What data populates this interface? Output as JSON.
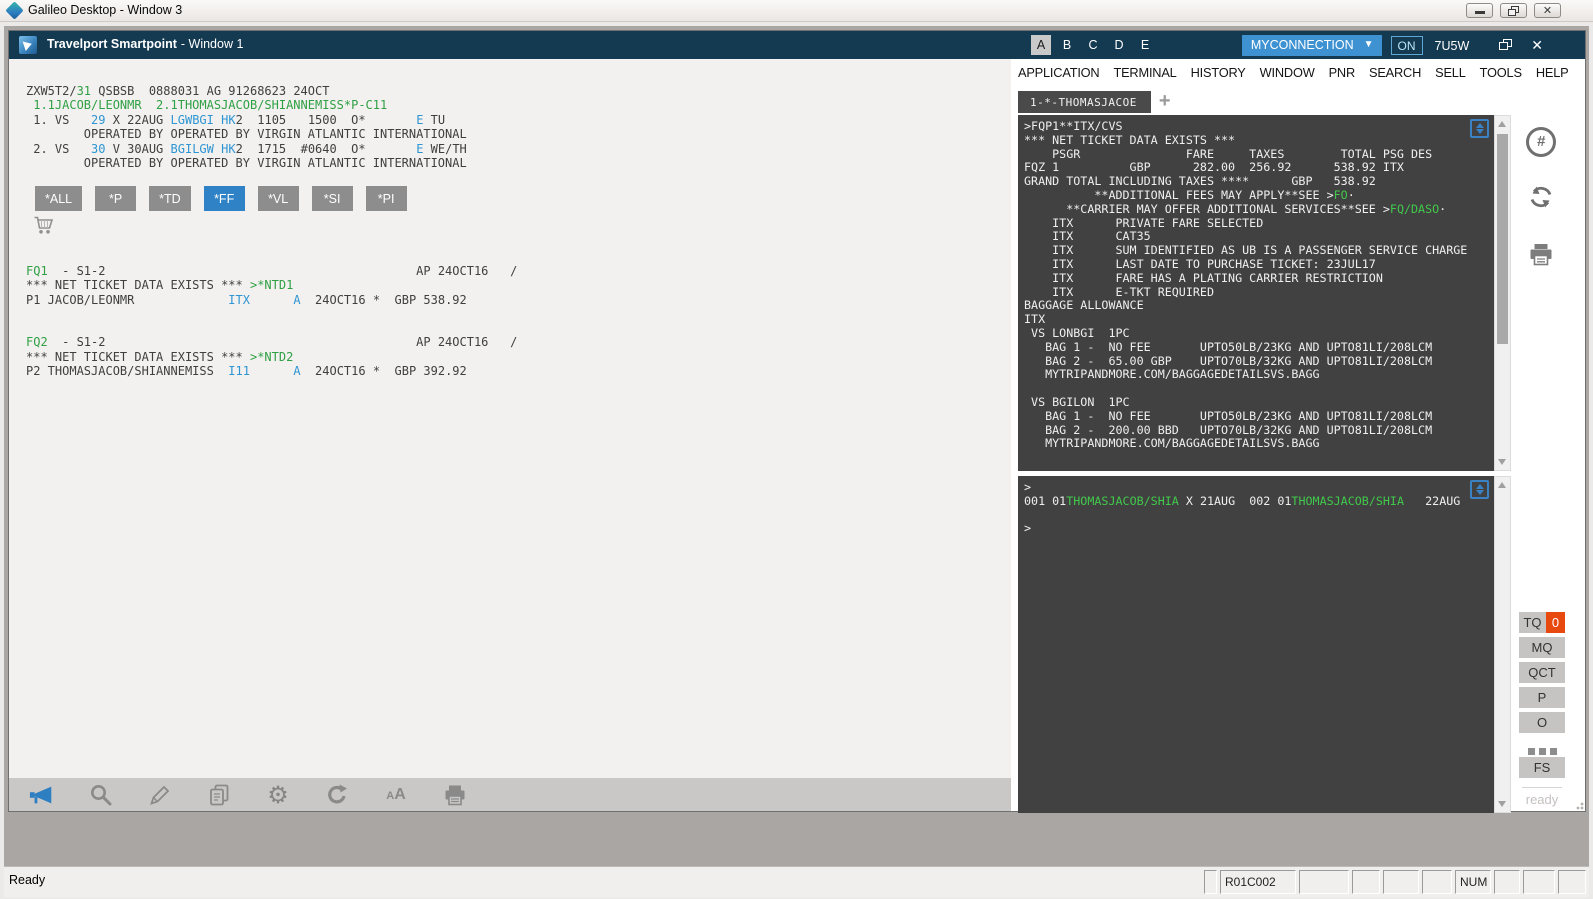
{
  "colors": {
    "titlebar": "#143a52",
    "accent_blue": "#2e82c5",
    "link_blue": "#2e95d3",
    "pnr_green": "#2fa044",
    "terminal_bg": "#414141",
    "terminal_green": "#41c94b",
    "alert_orange": "#e8490f",
    "panel_bg": "#f2f1ef",
    "button_gray": "#8d8d8d"
  },
  "outer": {
    "title": "Galileo Desktop - Window 3",
    "status_ready": "Ready",
    "status_cells": [
      "",
      "R01C002",
      "",
      "",
      "",
      "",
      "NUM",
      "",
      "",
      ""
    ]
  },
  "smartpoint": {
    "title_app": "Travelport Smartpoint",
    "title_window": "- Window 1",
    "view_tabs": [
      "A",
      "B",
      "C",
      "D",
      "E"
    ],
    "active_view_tab": "A",
    "connection_label": "MYCONNECTION",
    "on_label": "ON",
    "pcc": "7U5W",
    "menu": [
      "APPLICATION",
      "TERMINAL",
      "HISTORY",
      "WINDOW",
      "PNR",
      "SEARCH",
      "SELL",
      "TOOLS",
      "HELP"
    ]
  },
  "pnr": {
    "lines": [
      [
        [
          "ZXW5T2/",
          "d"
        ],
        [
          "31",
          "g"
        ],
        [
          " QSBSB  0888031 AG 91268623 24OCT",
          "d"
        ]
      ],
      [
        [
          " 1.1JACOB/LEONMR  2.1THOMASJACOB/SHIANNEMISS*P-C11",
          "g"
        ]
      ],
      [
        [
          " 1. VS   ",
          "d"
        ],
        [
          "29",
          "b"
        ],
        [
          " X 22AUG ",
          "d"
        ],
        [
          "LGWBGI",
          "b"
        ],
        [
          " ",
          "d"
        ],
        [
          "HK",
          "b"
        ],
        [
          "2",
          "d"
        ],
        [
          "  1105   1500  O*       ",
          "d"
        ],
        [
          "E",
          "b"
        ],
        [
          " TU",
          "d"
        ]
      ],
      [
        [
          "        OPERATED BY OPERATED BY VIRGIN ATLANTIC INTERNATIONAL",
          "d"
        ]
      ],
      [
        [
          " 2. VS   ",
          "d"
        ],
        [
          "30",
          "b"
        ],
        [
          " V 30AUG ",
          "d"
        ],
        [
          "BGILGW",
          "b"
        ],
        [
          " ",
          "d"
        ],
        [
          "HK",
          "b"
        ],
        [
          "2",
          "d"
        ],
        [
          "  1715  #0640  O*       ",
          "d"
        ],
        [
          "E",
          "b"
        ],
        [
          " WE/TH",
          "d"
        ]
      ],
      [
        [
          "        OPERATED BY OPERATED BY VIRGIN ATLANTIC INTERNATIONAL",
          "d"
        ]
      ]
    ],
    "format_buttons": [
      {
        "label": "*ALL",
        "active": false
      },
      {
        "label": "*P",
        "active": false
      },
      {
        "label": "*TD",
        "active": false
      },
      {
        "label": "*FF",
        "active": true
      },
      {
        "label": "*VL",
        "active": false
      },
      {
        "label": "*SI",
        "active": false
      },
      {
        "label": "*PI",
        "active": false
      }
    ],
    "fq_lines": [
      [
        [
          "FQ1",
          "g"
        ],
        [
          "  - S1-2                                           AP 24OCT16   /",
          "d"
        ]
      ],
      [
        [
          "*** NET TICKET DATA EXISTS *** ",
          "d"
        ],
        [
          ">*NTD1",
          "g"
        ]
      ],
      [
        [
          "P1 JACOB/LEONMR             ",
          "d"
        ],
        [
          "ITX",
          "b"
        ],
        [
          "      ",
          "d"
        ],
        [
          "A",
          "b"
        ],
        [
          "  24OCT16 *  GBP 538.92",
          "d"
        ]
      ],
      [],
      [],
      [
        [
          "FQ2",
          "g"
        ],
        [
          "  - S1-2                                           AP 24OCT16   /",
          "d"
        ]
      ],
      [
        [
          "*** NET TICKET DATA EXISTS *** ",
          "d"
        ],
        [
          ">*NTD2",
          "g"
        ]
      ],
      [
        [
          "P2 THOMASJACOB/SHIANNEMISS  ",
          "d"
        ],
        [
          "I11",
          "b"
        ],
        [
          "      ",
          "d"
        ],
        [
          "A",
          "b"
        ],
        [
          "  24OCT16 *  GBP 392.92",
          "d"
        ]
      ]
    ]
  },
  "terminal": {
    "session_tab": "1-*-THOMASJACOE",
    "new_session_label": "+",
    "screen1": [
      [
        [
          ">FQP1**ITX/CVS",
          "w"
        ]
      ],
      [
        [
          "*** NET TICKET DATA EXISTS ***",
          "w"
        ]
      ],
      [
        [
          "    PSGR               FARE     TAXES        TOTAL PSG DES",
          "w"
        ]
      ],
      [
        [
          "FQZ 1          GBP      282.00  256.92      538.92 ITX",
          "w"
        ]
      ],
      [
        [
          "GRAND TOTAL INCLUDING TAXES ****      GBP   538.92",
          "w"
        ]
      ],
      [
        [
          "          **ADDITIONAL FEES MAY APPLY**SEE >",
          "w"
        ],
        [
          "FO",
          "g"
        ],
        [
          "·",
          "w"
        ]
      ],
      [
        [
          "      **CARRIER MAY OFFER ADDITIONAL SERVICES**SEE >",
          "w"
        ],
        [
          "FQ/DASO",
          "g"
        ],
        [
          "·",
          "w"
        ]
      ],
      [
        [
          "    ITX      PRIVATE FARE SELECTED",
          "w"
        ]
      ],
      [
        [
          "    ITX      CAT35",
          "w"
        ]
      ],
      [
        [
          "    ITX      SUM IDENTIFIED AS UB IS A PASSENGER SERVICE CHARGE",
          "w"
        ]
      ],
      [
        [
          "    ITX      LAST DATE TO PURCHASE TICKET: 23JUL17",
          "w"
        ]
      ],
      [
        [
          "    ITX      FARE HAS A PLATING CARRIER RESTRICTION",
          "w"
        ]
      ],
      [
        [
          "    ITX      E-TKT REQUIRED",
          "w"
        ]
      ],
      [
        [
          "BAGGAGE ALLOWANCE",
          "w"
        ]
      ],
      [
        [
          "ITX",
          "w"
        ]
      ],
      [
        [
          " VS LONBGI  1PC",
          "w"
        ]
      ],
      [
        [
          "   BAG 1 -  NO FEE       UPTO50LB/23KG AND UPTO81LI/208LCM",
          "w"
        ]
      ],
      [
        [
          "   BAG 2 -  65.00 GBP    UPTO70LB/32KG AND UPTO81LI/208LCM",
          "w"
        ]
      ],
      [
        [
          "   MYTRIPANDMORE.COM/BAGGAGEDETAILSVS.BAGG",
          "w"
        ]
      ],
      [],
      [
        [
          " VS BGILON  1PC",
          "w"
        ]
      ],
      [
        [
          "   BAG 1 -  NO FEE       UPTO50LB/23KG AND UPTO81LI/208LCM",
          "w"
        ]
      ],
      [
        [
          "   BAG 2 -  200.00 BBD   UPTO70LB/32KG AND UPTO81LI/208LCM",
          "w"
        ]
      ],
      [
        [
          "   MYTRIPANDMORE.COM/BAGGAGEDETAILSVS.BAGG",
          "w"
        ]
      ]
    ],
    "screen2": [
      [
        [
          ">",
          "w"
        ]
      ],
      [
        [
          "001 01",
          "w"
        ],
        [
          "THOMASJACOB/SHIA",
          "g"
        ],
        [
          " X 21AUG  002 01",
          "w"
        ],
        [
          "THOMASJACOB/SHIA",
          "g"
        ],
        [
          "   22AUG",
          "w"
        ]
      ],
      [],
      [
        [
          ">",
          "w"
        ]
      ]
    ]
  },
  "rail": {
    "tq_label": "TQ",
    "tq_count": "0",
    "queue_badges": [
      "MQ",
      "QCT",
      "P",
      "O"
    ],
    "fs_label": "FS",
    "ready_label": "ready"
  }
}
